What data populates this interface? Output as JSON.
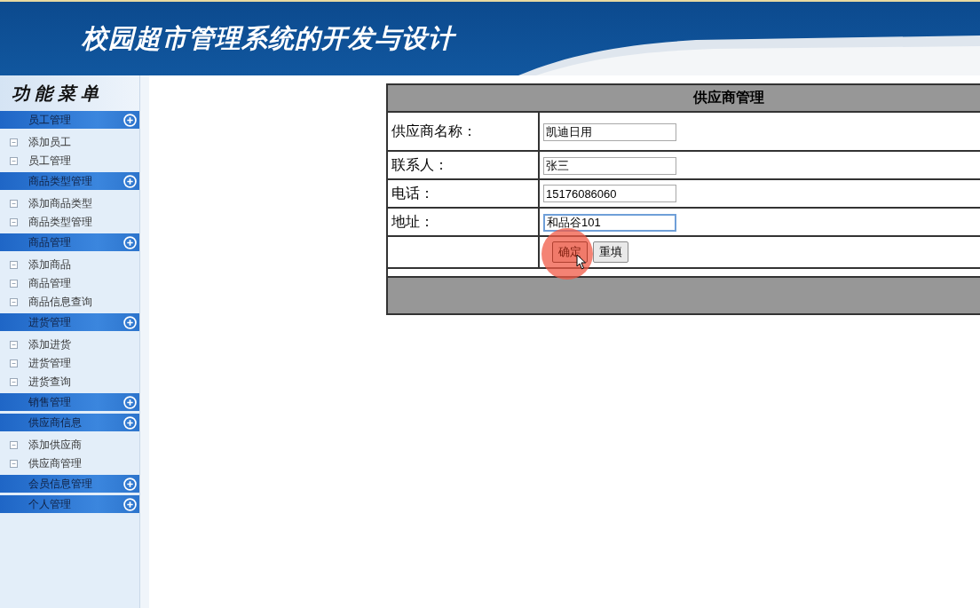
{
  "header": {
    "title": "校园超市管理系统的开发与设计"
  },
  "sidebar": {
    "title": "功能菜单",
    "groups": [
      {
        "label": "员工管理",
        "items": [
          "添加员工",
          "员工管理"
        ]
      },
      {
        "label": "商品类型管理",
        "items": [
          "添加商品类型",
          "商品类型管理"
        ]
      },
      {
        "label": "商品管理",
        "items": [
          "添加商品",
          "商品管理",
          "商品信息查询"
        ]
      },
      {
        "label": "进货管理",
        "items": [
          "添加进货",
          "进货管理",
          "进货查询"
        ]
      },
      {
        "label": "销售管理"
      },
      {
        "label": "供应商信息",
        "items": [
          "添加供应商",
          "供应商管理"
        ]
      },
      {
        "label": "会员信息管理"
      },
      {
        "label": "个人管理"
      }
    ]
  },
  "form": {
    "title": "供应商管理",
    "fields": [
      {
        "label": "供应商名称：",
        "value": "凯迪日用",
        "focused": false
      },
      {
        "label": "联系人：",
        "value": "张三",
        "focused": false
      },
      {
        "label": "电话：",
        "value": "15176086060",
        "focused": false
      },
      {
        "label": "地址：",
        "value": "和品谷101",
        "focused": true
      }
    ],
    "buttons": [
      {
        "label": "确定",
        "clicked": true
      },
      {
        "label": "重填",
        "clicked": false
      }
    ]
  }
}
